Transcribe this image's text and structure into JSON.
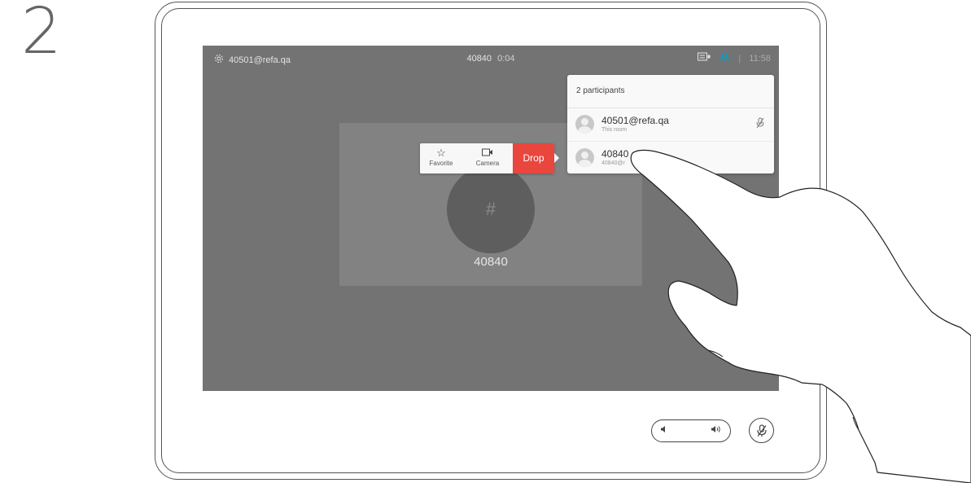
{
  "step": {
    "number": "2"
  },
  "topbar": {
    "self_address": "40501@refa.qa",
    "call_name": "40840",
    "call_timer": "0:04",
    "separator": "|",
    "clock": "11:58",
    "settings_icon": "gear-icon",
    "layout_icon": "layout-icon",
    "participants_icon": "participants-icon",
    "accent_color": "#00a0d1"
  },
  "call": {
    "avatar_glyph": "#",
    "name": "40840"
  },
  "actions": {
    "favorite_label": "Favorite",
    "camera_label": "Camera",
    "drop_label": "Drop",
    "drop_color": "#e9463e"
  },
  "participants_panel": {
    "header": "2 participants",
    "rows": [
      {
        "name": "40501@refa.qa",
        "sub": "This room",
        "muted": true
      },
      {
        "name": "40840",
        "sub": "40840@r"
      }
    ]
  },
  "controls": {
    "volume_icon_low": "volume-low-icon",
    "volume_icon_high": "volume-high-icon",
    "mic_icon": "mic-muted-icon"
  }
}
